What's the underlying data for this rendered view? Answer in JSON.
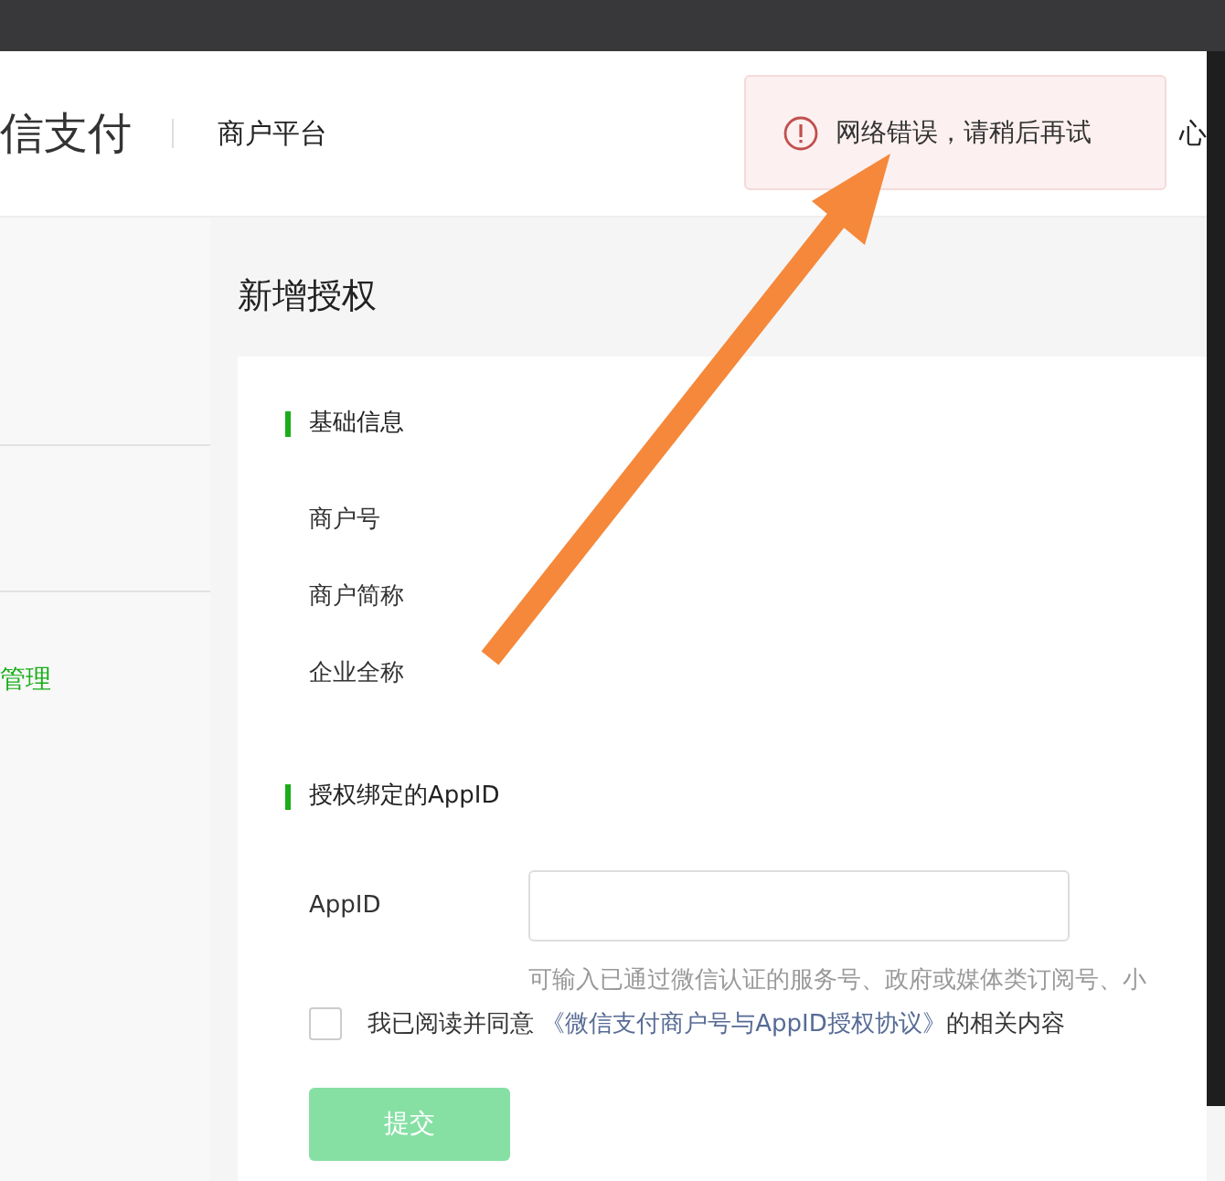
{
  "header": {
    "brand": "信支付",
    "platform": "商户平台",
    "nav_item": "心"
  },
  "toast": {
    "kind": "error",
    "message": "网络错误，请稍后再试"
  },
  "sidebar": {
    "items": [
      {
        "label": "管理",
        "selected": true
      }
    ]
  },
  "page_title": "新增授权",
  "sections": [
    {
      "title": "基础信息",
      "fields": [
        {
          "kind": "text",
          "label": "商户号"
        },
        {
          "kind": "text",
          "label": "商户简称"
        },
        {
          "kind": "text",
          "label": "企业全称"
        }
      ]
    },
    {
      "title": "授权绑定的AppID",
      "fields": [
        {
          "kind": "input",
          "label": "AppID",
          "hint": "可输入已通过微信认证的服务号、政府或媒体类订阅号、小"
        }
      ]
    }
  ],
  "agreement": {
    "checked": false,
    "prefix": "我已阅读并同意",
    "link": "《微信支付商户号与AppID授权协议》",
    "suffix": "的相关内容"
  },
  "submit": {
    "label": "提交",
    "disabled": true
  }
}
